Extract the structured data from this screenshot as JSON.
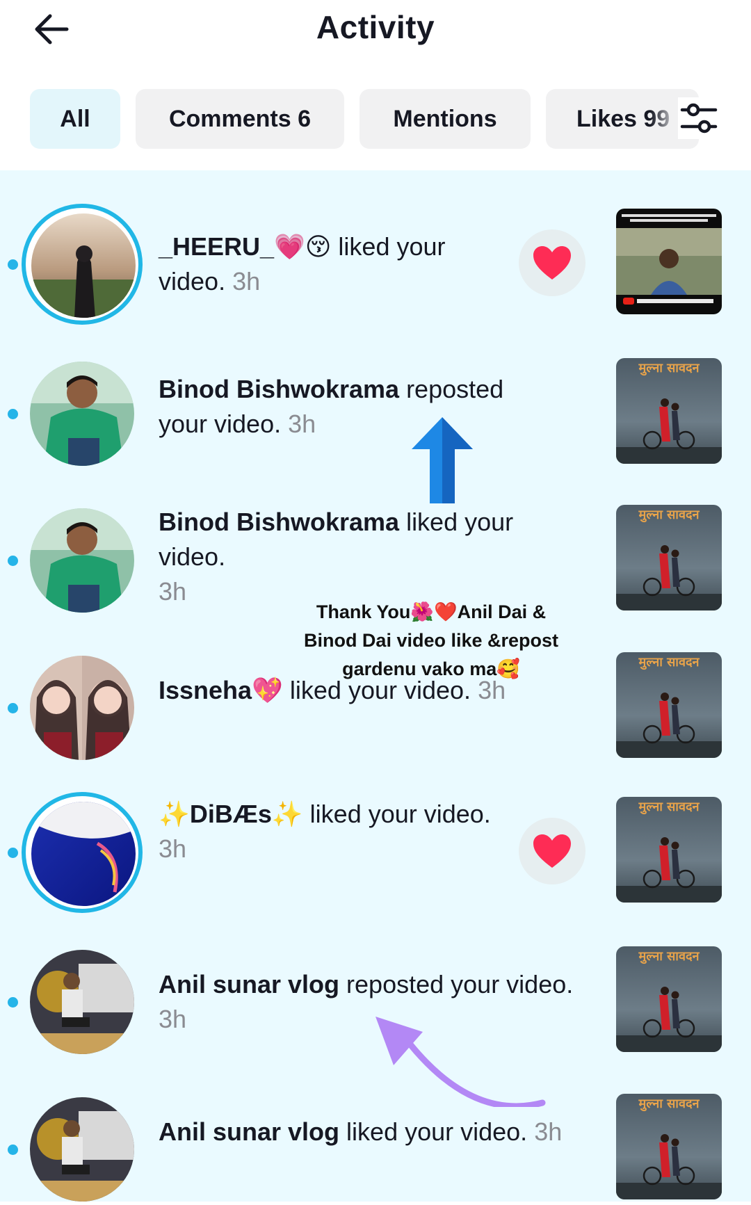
{
  "header": {
    "title": "Activity",
    "back_icon": "arrow-left-icon",
    "filter_icon": "sliders-icon"
  },
  "tabs": [
    {
      "label": "All",
      "active": true
    },
    {
      "label": "Comments 6",
      "active": false
    },
    {
      "label": "Mentions",
      "active": false
    },
    {
      "label": "Likes 99",
      "active": false
    }
  ],
  "notifications": [
    {
      "name": "_HEERU_💗😚",
      "action": " liked your video.",
      "time": "3h",
      "like_button": true,
      "thumb": "youtube-video-thumbnail"
    },
    {
      "name": "Binod Bishwokrama",
      "action": " reposted your video.",
      "time": "3h",
      "like_button": false,
      "thumb": "movie-poster-thumbnail"
    },
    {
      "name": "Binod Bishwokrama",
      "action": " liked your video.",
      "time": "3h",
      "like_button": false,
      "thumb": "movie-poster-thumbnail"
    },
    {
      "name": "Issneha💖",
      "action": " liked your video.",
      "time": "3h",
      "like_button": false,
      "thumb": "movie-poster-thumbnail"
    },
    {
      "name": "✨DiBÆs✨",
      "action": " liked your video.",
      "time": "3h",
      "like_button": true,
      "thumb": "movie-poster-thumbnail"
    },
    {
      "name": "Anil sunar vlog",
      "action": " reposted your video.",
      "time": "3h",
      "like_button": false,
      "thumb": "movie-poster-thumbnail"
    },
    {
      "name": "Anil sunar vlog",
      "action": " liked your video.",
      "time": "3h",
      "like_button": false,
      "thumb": "movie-poster-thumbnail"
    }
  ],
  "overlay_note": {
    "line1": "Thank You🌺❤️Anil Dai &",
    "line2": "Binod Dai  video like &repost",
    "line3": "gardenu vako ma🥰"
  },
  "colors": {
    "accent": "#25b4e8",
    "list_bg": "#eafaff",
    "heart": "#fe2c55",
    "arrow_blue": "#1e88e5",
    "arrow_purple": "#b388f5"
  }
}
